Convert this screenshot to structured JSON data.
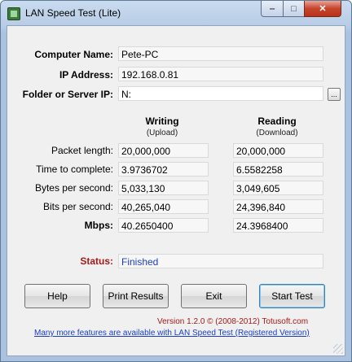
{
  "window": {
    "title": "LAN Speed Test (Lite)",
    "minimize": "‒",
    "maximize": "□",
    "close": "✕"
  },
  "info": {
    "computer_name_label": "Computer Name:",
    "computer_name_value": "Pete-PC",
    "ip_label": "IP Address:",
    "ip_value": "192.168.0.81",
    "folder_label": "Folder or Server IP:",
    "folder_value": "N:",
    "browse_label": "..."
  },
  "columns": {
    "writing": "Writing",
    "writing_sub": "(Upload)",
    "reading": "Reading",
    "reading_sub": "(Download)"
  },
  "rows": [
    {
      "label": "Packet length:",
      "write": "20,000,000",
      "read": "20,000,000"
    },
    {
      "label": "Time to complete:",
      "write": "3.9736702",
      "read": "6.5582258"
    },
    {
      "label": "Bytes per second:",
      "write": "5,033,130",
      "read": "3,049,605"
    },
    {
      "label": "Bits per second:",
      "write": "40,265,040",
      "read": "24,396,840"
    },
    {
      "label": "Mbps:",
      "write": "40.2650400",
      "read": "24.3968400"
    }
  ],
  "status": {
    "label": "Status:",
    "value": "Finished"
  },
  "buttons": {
    "help": "Help",
    "print": "Print Results",
    "exit": "Exit",
    "start": "Start Test"
  },
  "footer": {
    "version": "Version 1.2.0  © (2008-2012) Totusoft.com",
    "link": "Many more features are available with LAN Speed Test (Registered Version)"
  },
  "colors": {
    "status_label": "#a31a1a",
    "status_value": "#1a3fc4",
    "link": "#1a3fc4"
  }
}
